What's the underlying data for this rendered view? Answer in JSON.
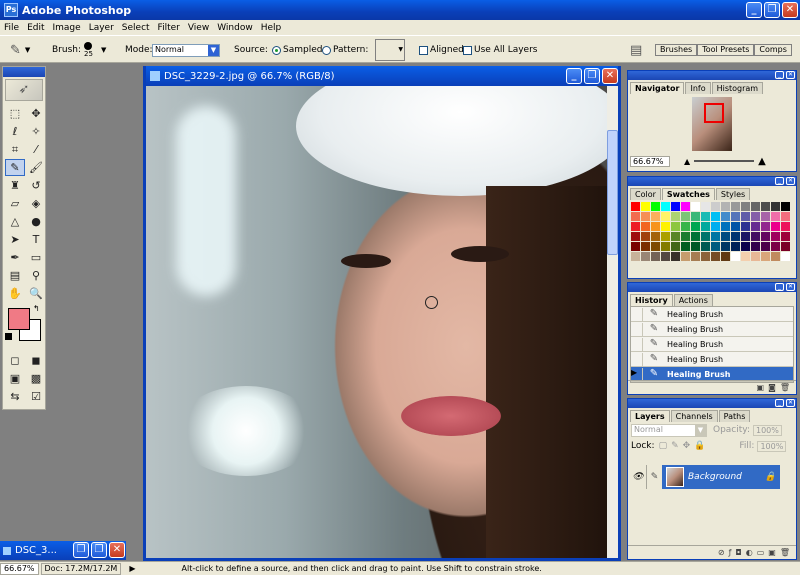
{
  "app": {
    "title": "Adobe Photoshop",
    "logo": "Ps"
  },
  "window_buttons": {
    "minimize": "_",
    "restore": "❐",
    "close": "✕"
  },
  "menu": [
    "File",
    "Edit",
    "Image",
    "Layer",
    "Select",
    "Filter",
    "View",
    "Window",
    "Help"
  ],
  "options": {
    "brush_label": "Brush:",
    "brush_size": "25",
    "mode_label": "Mode:",
    "mode_value": "Normal",
    "source_label": "Source:",
    "sampled_label": "Sampled",
    "pattern_label": "Pattern:",
    "aligned_label": "Aligned",
    "use_all_layers_label": "Use All Layers",
    "well_tabs": [
      "Brushes",
      "Tool Presets",
      "Comps"
    ]
  },
  "document": {
    "title": "DSC_3229-2.jpg @ 66.7% (RGB/8)"
  },
  "navigator": {
    "tabs": [
      "Navigator",
      "Info",
      "Histogram"
    ],
    "zoom": "66.67%"
  },
  "color_panel": {
    "tabs": [
      "Color",
      "Swatches",
      "Styles"
    ]
  },
  "swatch_colors": [
    "#ff0000",
    "#ffff00",
    "#00ff00",
    "#00ffff",
    "#0000ff",
    "#ff00ff",
    "#ffffff",
    "#e6e6e6",
    "#cccccc",
    "#b3b3b3",
    "#999999",
    "#808080",
    "#666666",
    "#4d4d4d",
    "#333333",
    "#000000",
    "#f26c4f",
    "#f68e55",
    "#fbaf5c",
    "#fff467",
    "#acd372",
    "#7cc576",
    "#3bb878",
    "#1abbb4",
    "#00bff3",
    "#438ccb",
    "#5574b9",
    "#605ca8",
    "#855fa8",
    "#a763a8",
    "#f06ea9",
    "#f26d7d",
    "#ed1c24",
    "#f26522",
    "#f7941d",
    "#fff200",
    "#8dc63f",
    "#39b54a",
    "#00a651",
    "#00a99d",
    "#00aeef",
    "#0072bc",
    "#0054a6",
    "#2e3192",
    "#662d91",
    "#92278f",
    "#ec008c",
    "#ed145b",
    "#9e0b0f",
    "#a0410d",
    "#a36209",
    "#aba000",
    "#598527",
    "#1a7b30",
    "#007236",
    "#00746b",
    "#0076a3",
    "#004b80",
    "#003471",
    "#1b1464",
    "#440e62",
    "#630460",
    "#9e005d",
    "#9e0039",
    "#790000",
    "#7b2e00",
    "#7d4900",
    "#827b00",
    "#406618",
    "#005e20",
    "#005826",
    "#005952",
    "#005b7f",
    "#003663",
    "#002157",
    "#0d004c",
    "#32004b",
    "#4b0049",
    "#7b0046",
    "#7a0026",
    "#c7b299",
    "#998675",
    "#736357",
    "#534741",
    "#37302a",
    "#c69c6d",
    "#a67c52",
    "#8c6239",
    "#754c24",
    "#603913",
    "#ffffff",
    "#f4cfae",
    "#e8b796",
    "#d9a67a",
    "#c08a5e",
    "#ffffff"
  ],
  "history": {
    "tabs": [
      "History",
      "Actions"
    ],
    "items": [
      "Healing Brush",
      "Healing Brush",
      "Healing Brush",
      "Healing Brush",
      "Healing Brush"
    ]
  },
  "layers": {
    "tabs": [
      "Layers",
      "Channels",
      "Paths"
    ],
    "blend_mode": "Normal",
    "opacity_label": "Opacity:",
    "opacity_value": "100%",
    "lock_label": "Lock:",
    "fill_label": "Fill:",
    "fill_value": "100%",
    "background_layer": "Background"
  },
  "minimized_doc": {
    "title": "DSC_3..."
  },
  "status": {
    "zoom": "66.67%",
    "doc_size": "Doc: 17.2M/17.2M",
    "hint": "Alt-click to define a source, and then click and drag to paint. Use Shift to constrain stroke."
  }
}
